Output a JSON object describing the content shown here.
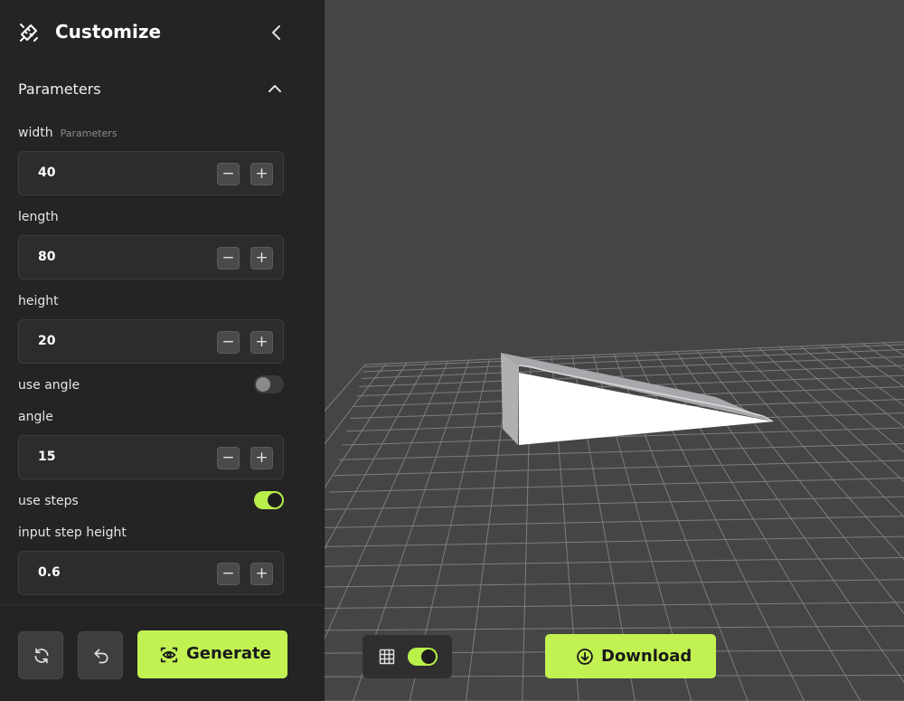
{
  "sidebar": {
    "title": "Customize",
    "section": "Parameters",
    "params": {
      "width": {
        "label": "width",
        "sublabel": "Parameters",
        "value": "40"
      },
      "length": {
        "label": "length",
        "value": "80"
      },
      "height": {
        "label": "height",
        "value": "20"
      },
      "use_angle": {
        "label": "use angle",
        "enabled": false
      },
      "angle": {
        "label": "angle",
        "value": "15"
      },
      "use_steps": {
        "label": "use steps",
        "enabled": true
      },
      "step_height": {
        "label": "input step height",
        "value": "0.6"
      }
    },
    "minus": "−",
    "plus": "+",
    "generate_label": "Generate"
  },
  "viewport": {
    "grid_enabled": true,
    "download_label": "Download"
  },
  "colors": {
    "accent": "#c2f252",
    "sidebar_bg": "#242424",
    "viewport_bg": "#454545"
  },
  "icons": {
    "logo": "pencil-ruler-icon",
    "collapse": "chevron-left-icon",
    "section_toggle": "chevron-up-icon",
    "reset": "refresh-icon",
    "undo": "undo-icon",
    "generate": "eye-scan-icon",
    "grid": "grid-icon",
    "download": "download-circle-icon"
  }
}
